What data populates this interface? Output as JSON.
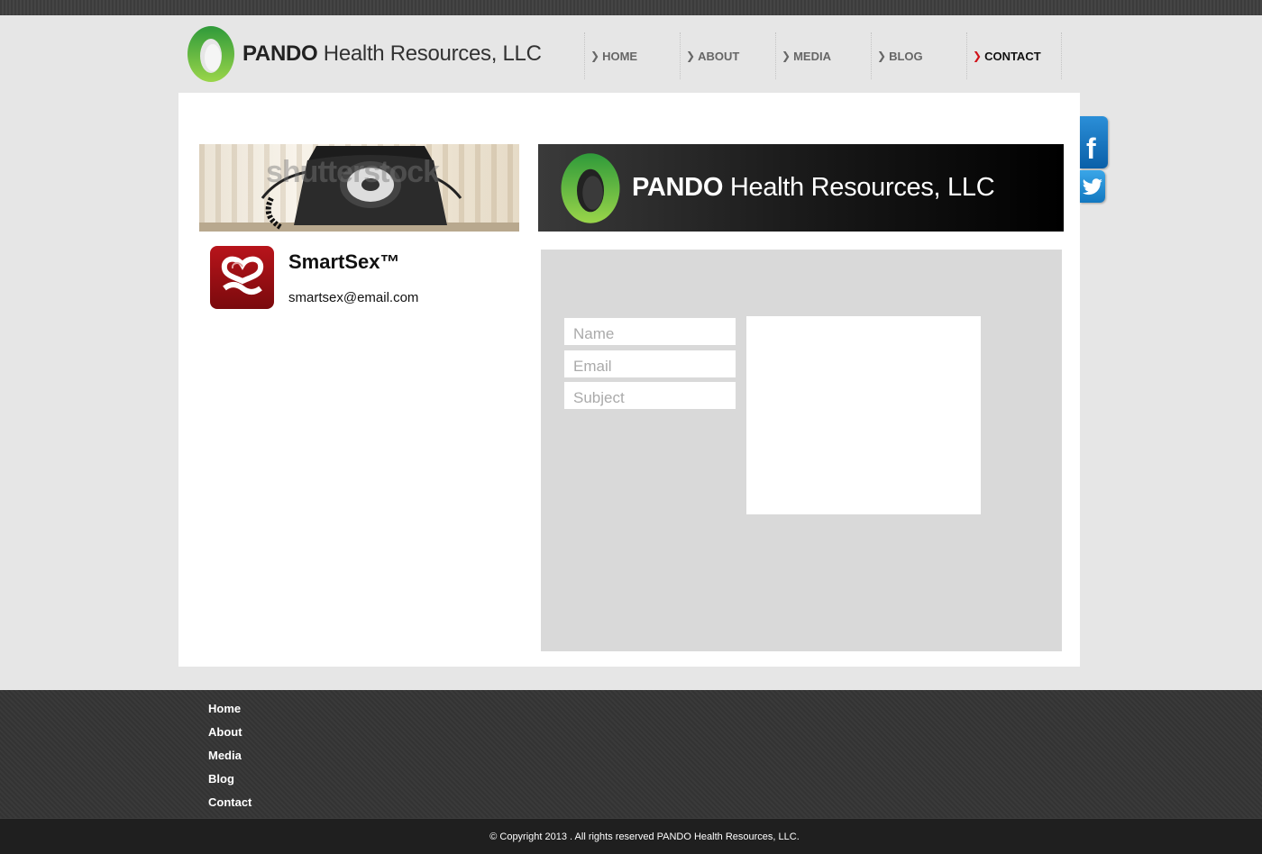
{
  "brand": {
    "name_bold": "PANDO",
    "name_rest": "Health Resources, LLC",
    "accent": "#7cc242"
  },
  "nav": {
    "items": [
      {
        "label": "HOME",
        "active": false
      },
      {
        "label": "ABOUT",
        "active": false
      },
      {
        "label": "MEDIA",
        "active": false
      },
      {
        "label": "BLOG",
        "active": false
      },
      {
        "label": "CONTACT",
        "active": true
      }
    ],
    "active_color": "#d0121a"
  },
  "banner": {
    "watermark": "shutterstock"
  },
  "app": {
    "name": "SmartSex™",
    "email": "smartsex@email.com",
    "icon_color": "#9e1016"
  },
  "header_banner": {
    "name_bold": "PANDO",
    "name_rest": "Health Resources, LLC"
  },
  "form": {
    "name_placeholder": "Name",
    "email_placeholder": "Email",
    "subject_placeholder": "Subject",
    "message_placeholder": ""
  },
  "social": {
    "facebook_icon": "facebook-icon",
    "twitter_icon": "twitter-icon"
  },
  "footer": {
    "links": [
      "Home",
      "About",
      "Media",
      "Blog",
      "Contact"
    ],
    "copyright": "© Copyright 2013 . All rights reserved  PANDO Health Resources, LLC."
  }
}
